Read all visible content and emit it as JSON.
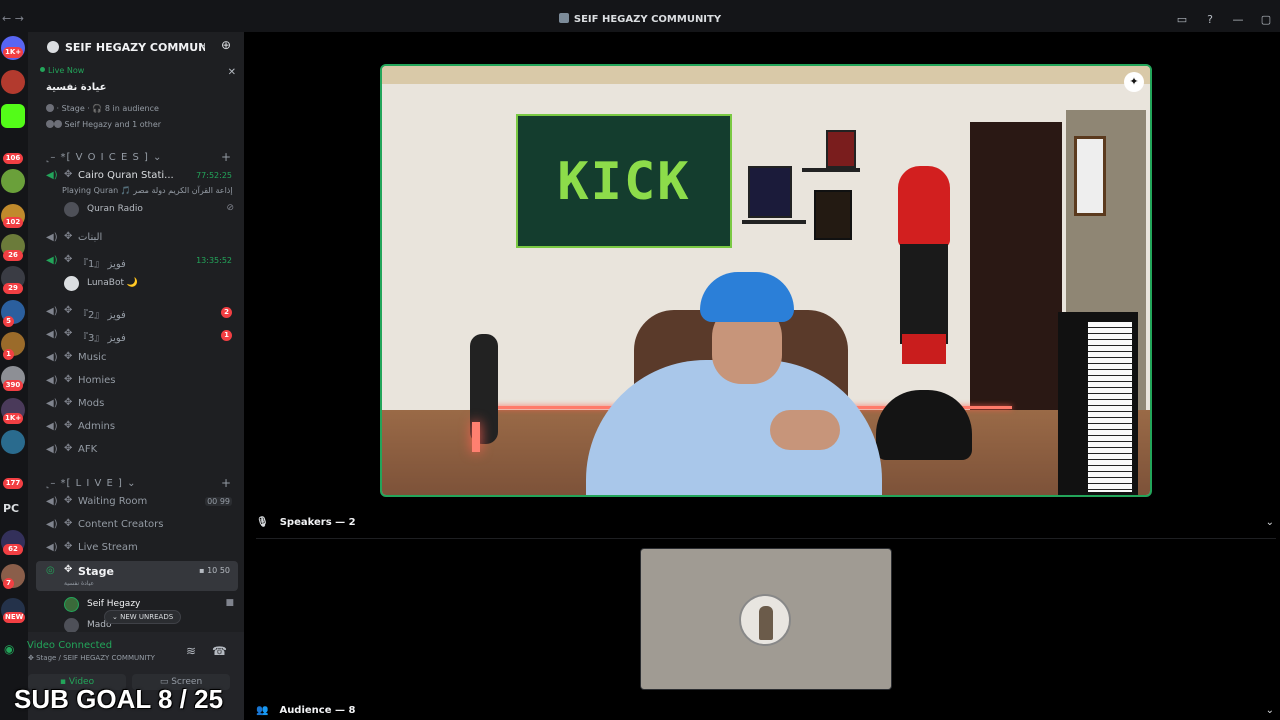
{
  "titlebar": {
    "back": "←",
    "forward": "→",
    "title": "SEIF HEGAZY COMMUNITY"
  },
  "guilds": {
    "badges": [
      "1K+",
      "106",
      "102",
      "26",
      "29",
      "5",
      "1",
      "390",
      "1K+",
      "177",
      "62",
      "7",
      "NEW"
    ],
    "pc_label": "PC"
  },
  "server": {
    "name": "SEIF HEGAZY COMMUNI...",
    "chevron": "⌄"
  },
  "live_now": {
    "label": "Live Now",
    "title": "عيادة نفسية",
    "meta": "· Stage · 🎧 8 in audience",
    "who": "Seif Hegazy and 1 other",
    "close": "✕"
  },
  "categories": {
    "voices": "˻–  *[ V O I C E S ] ⌄",
    "live": "˻–  *[ L I V E ] ⌄",
    "plus": "+"
  },
  "voice_channels": [
    {
      "name": "Cairo Quran Stati...",
      "time": "77:52:25"
    },
    {
      "name": "البنات"
    },
    {
      "name": "『1』 فويز",
      "time": "13:35:52"
    },
    {
      "name": "『2』 فويز",
      "badge": "2"
    },
    {
      "name": "『3』 فويز",
      "badge": "1"
    },
    {
      "name": "Music"
    },
    {
      "name": "Homies"
    },
    {
      "name": "Mods"
    },
    {
      "name": "Admins"
    },
    {
      "name": "AFK"
    }
  ],
  "cairo_sub": "Playing Quran 🎵 إذاعة القرآن الكريم دولة مصر",
  "users": {
    "quran_radio": "Quran Radio",
    "lunabot": "LunaBot 🌙",
    "seif": "Seif Hegazy",
    "mado": "Mado"
  },
  "live_channels": [
    {
      "name": "Waiting Room",
      "count": "00 99"
    },
    {
      "name": "Content Creators"
    },
    {
      "name": "Live Stream"
    },
    {
      "name": "Stage",
      "count": "10   50",
      "sub": "عيادة نفسية"
    }
  ],
  "new_unreads": "⌄ NEW UNREADS",
  "voice_panel": {
    "status": "Video Connected",
    "location": "Stage / SEIF HEGAZY COMMUNITY",
    "video_btn": "Video",
    "screen_btn": "Screen"
  },
  "overlay": {
    "sub_goal": "SUB GOAL 8 / 25"
  },
  "stage": {
    "speakers_label": "Speakers — 2",
    "audience_label": "Audience — 8",
    "banner_text": "KICK"
  }
}
